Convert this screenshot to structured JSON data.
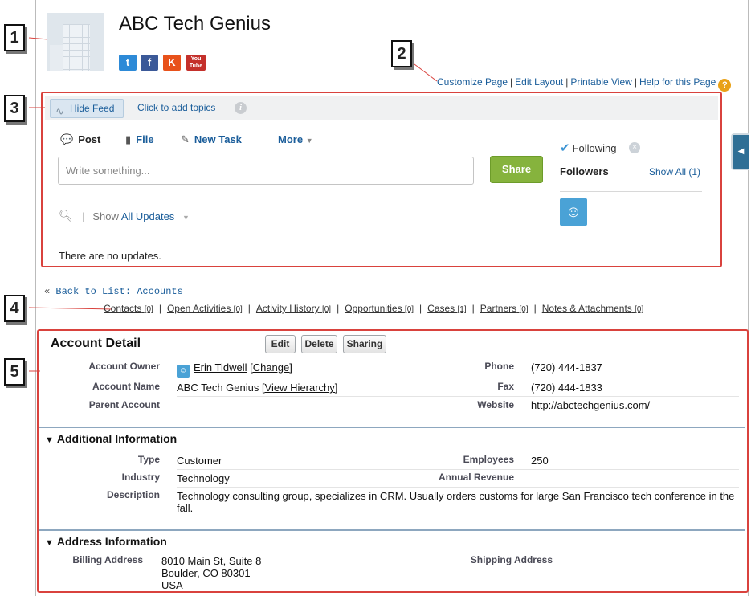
{
  "callouts": [
    "1",
    "2",
    "3",
    "4",
    "5"
  ],
  "account": {
    "name": "ABC Tech Genius",
    "social": [
      "twitter-icon",
      "facebook-icon",
      "klout-icon",
      "youtube-icon"
    ],
    "social_glyphs": [
      "t",
      "f",
      "K",
      "You Tube"
    ]
  },
  "page_links": {
    "customize": "Customize Page",
    "edit_layout": "Edit Layout",
    "printable": "Printable View",
    "help": "Help for this Page",
    "sep": "|"
  },
  "feed": {
    "hide_feed": "Hide Feed",
    "add_topics": "Click to add topics",
    "tabs": {
      "post": "Post",
      "file": "File",
      "new_task": "New Task",
      "more": "More"
    },
    "placeholder": "Write something...",
    "share": "Share",
    "show_prefix": "Show",
    "show_filter": "All Updates",
    "empty": "There are no updates.",
    "following": "Following",
    "followers": "Followers",
    "show_all": "Show All (1)"
  },
  "back_link": "Back to List: Accounts",
  "related": [
    {
      "label": "Contacts",
      "count": "[0]"
    },
    {
      "label": "Open Activities",
      "count": "[0]"
    },
    {
      "label": "Activity History",
      "count": "[0]"
    },
    {
      "label": "Opportunities",
      "count": "[0]"
    },
    {
      "label": "Cases",
      "count": "[1]"
    },
    {
      "label": "Partners",
      "count": "[0]"
    },
    {
      "label": "Notes & Attachments",
      "count": "[0]"
    }
  ],
  "detail": {
    "title": "Account Detail",
    "buttons": {
      "edit": "Edit",
      "delete": "Delete",
      "sharing": "Sharing"
    },
    "owner_label": "Account Owner",
    "owner": "Erin Tidwell",
    "change": "[Change]",
    "name_label": "Account Name",
    "name_value": "ABC Tech Genius",
    "view_hierarchy": "[View Hierarchy]",
    "parent_label": "Parent Account",
    "phone_label": "Phone",
    "phone": "(720) 444-1837",
    "fax_label": "Fax",
    "fax": "(720) 444-1833",
    "website_label": "Website",
    "website": "http://abctechgenius.com/"
  },
  "additional": {
    "title": "Additional Information",
    "type_label": "Type",
    "type": "Customer",
    "employees_label": "Employees",
    "employees": "250",
    "industry_label": "Industry",
    "industry": "Technology",
    "revenue_label": "Annual Revenue",
    "description_label": "Description",
    "description": "Technology consulting group, specializes in CRM. Usually orders customs for large San Francisco tech conference in the fall."
  },
  "address": {
    "title": "Address Information",
    "billing_label": "Billing Address",
    "billing_line1": "8010 Main St, Suite 8",
    "billing_line2": "Boulder, CO 80301",
    "billing_line3": "USA",
    "shipping_label": "Shipping Address"
  },
  "colors": {
    "link": "#1a5d9a",
    "share": "#86b33d",
    "callout_box": "#d9423d"
  }
}
